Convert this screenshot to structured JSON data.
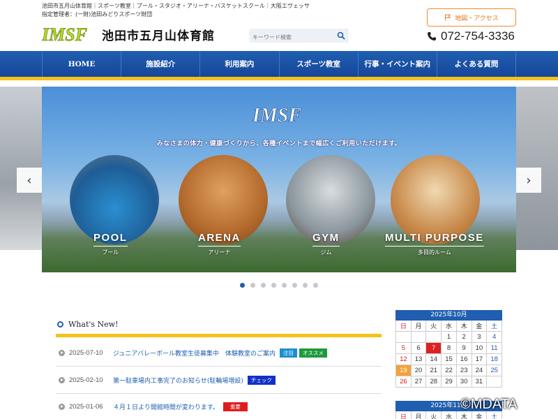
{
  "header": {
    "tagline": "池田市五月山体育館｜スポーツ教室｜プール・スタジオ・アリーナ・バスケットスクール｜大阪エヴェッサ",
    "admin": "指定管理者：(一財)池田みどりスポーツ財団",
    "logo_text": "IMSF",
    "site_title": "池田市五月山体育館",
    "search_placeholder": "キーワード検索",
    "map_button": "地図・アクセス",
    "phone": "072-754-3336"
  },
  "nav": {
    "items": [
      "HOME",
      "施設紹介",
      "利用案内",
      "スポーツ教室",
      "行事・イベント案内",
      "よくある質問"
    ]
  },
  "slider": {
    "logo_text": "IMSF",
    "caption": "みなさまの体力・健康づくりから、各種イベントまで幅広くご利用いただけます。",
    "categories": [
      {
        "en": "POOL",
        "jp": "プール"
      },
      {
        "en": "ARENA",
        "jp": "アリーナ"
      },
      {
        "en": "GYM",
        "jp": "ジム"
      },
      {
        "en": "MULTI PURPOSE",
        "jp": "多目的ルーム"
      }
    ],
    "prev": "‹",
    "next": "›",
    "dots_total": 8,
    "active_dot": 1
  },
  "news": {
    "heading": "What's New!",
    "items": [
      {
        "date": "2025-07-10",
        "title": "ジュニアバレーボール教室生徒募集中　体験教室のご案内",
        "badges": [
          {
            "label": "注目",
            "color": "#1a8fd0"
          },
          {
            "label": "オススメ",
            "color": "#1d9a3c"
          }
        ]
      },
      {
        "date": "2025-02-10",
        "title": "第一駐車場内工事完了のお知らせ(駐輪場増設)",
        "badges": [
          {
            "label": "チェック",
            "color": "#1430c8"
          }
        ]
      },
      {
        "date": "2025-01-06",
        "title": "４月１日より開館時間が変わります。",
        "badges": [
          {
            "label": "重要",
            "color": "#e01b1b"
          }
        ]
      }
    ]
  },
  "calendar": {
    "title": "2025年10月",
    "weekdays": [
      "日",
      "月",
      "火",
      "水",
      "木",
      "金",
      "土"
    ],
    "weeks": [
      [
        "",
        "",
        "",
        "1",
        "2",
        "3",
        "4"
      ],
      [
        "5",
        "6",
        "7",
        "8",
        "9",
        "10",
        "11"
      ],
      [
        "12",
        "13",
        "14",
        "15",
        "16",
        "17",
        "18"
      ],
      [
        "19",
        "20",
        "21",
        "22",
        "23",
        "24",
        "25"
      ],
      [
        "26",
        "27",
        "28",
        "29",
        "30",
        "31",
        ""
      ]
    ],
    "closed_day": "7",
    "holiday_day": "19",
    "next_title": "2025年11月",
    "next_weekdays": [
      "日",
      "月",
      "火",
      "水",
      "木",
      "金",
      "土"
    ]
  },
  "watermark": "©MDATA"
}
